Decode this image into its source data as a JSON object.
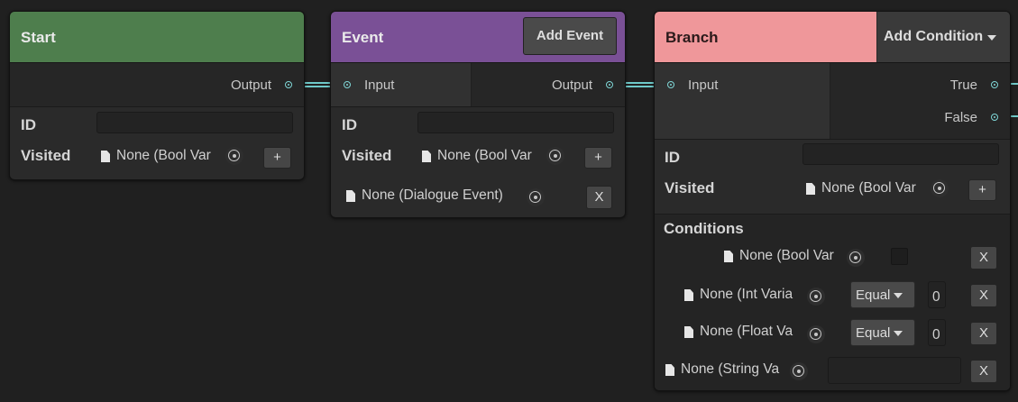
{
  "colors": {
    "start": "#4e7e4d",
    "event": "#7a5096",
    "branch": "#ef979a",
    "wire": "#6fc9c9"
  },
  "start": {
    "title": "Start",
    "output": "Output",
    "id_label": "ID",
    "id_value": "",
    "visited_label": "Visited",
    "visited_obj": "None (Bool Var",
    "add": "+"
  },
  "event": {
    "title": "Event",
    "add_event": "Add Event",
    "input": "Input",
    "output": "Output",
    "id_label": "ID",
    "id_value": "",
    "visited_label": "Visited",
    "visited_obj": "None (Bool Var",
    "add": "+",
    "dialogue_obj": "None (Dialogue Event)",
    "remove": "X"
  },
  "branch": {
    "title": "Branch",
    "add_condition": "Add Condition",
    "input": "Input",
    "true_port": "True",
    "false_port": "False",
    "id_label": "ID",
    "id_value": "",
    "visited_label": "Visited",
    "visited_obj": "None (Bool Var",
    "add": "+",
    "conditions_label": "Conditions",
    "cond_bool": {
      "obj": "None (Bool Var",
      "remove": "X"
    },
    "cond_int": {
      "obj": "None (Int Varia",
      "op": "Equal",
      "value": "0",
      "remove": "X"
    },
    "cond_float": {
      "obj": "None (Float Va",
      "op": "Equal",
      "value": "0",
      "remove": "X"
    },
    "cond_string": {
      "obj": "None (String Va",
      "value": "",
      "remove": "X"
    }
  },
  "icons": [
    "document-icon",
    "object-picker-icon",
    "port-icon",
    "dropdown-arrow-icon"
  ]
}
